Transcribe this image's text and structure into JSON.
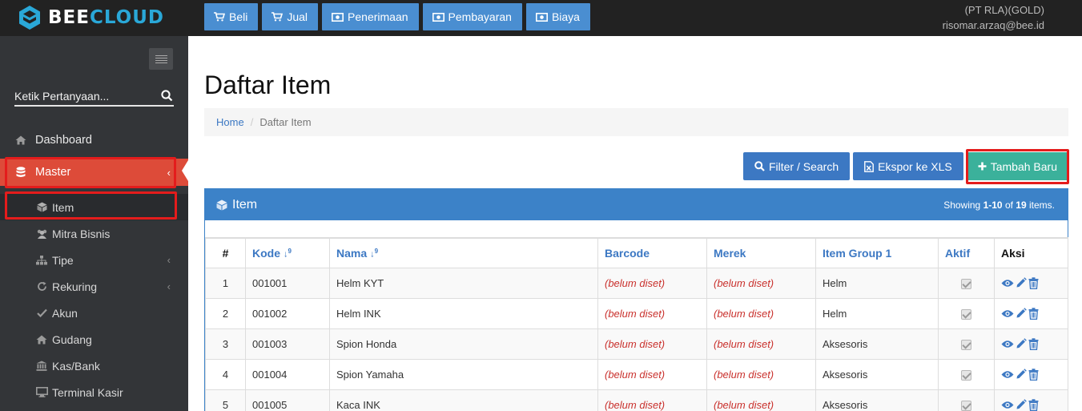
{
  "brand": {
    "part1": "BEE",
    "part2": "CLOUD"
  },
  "topnav": [
    {
      "icon": "cart-icon",
      "label": "Beli"
    },
    {
      "icon": "cart-icon",
      "label": "Jual"
    },
    {
      "icon": "money-icon",
      "label": "Penerimaan"
    },
    {
      "icon": "money-icon",
      "label": "Pembayaran"
    },
    {
      "icon": "money-icon",
      "label": "Biaya"
    }
  ],
  "company": {
    "name": "(PT RLA)(GOLD)",
    "email": "risomar.arzaq@bee.id"
  },
  "sidebar": {
    "search_placeholder": "Ketik Pertanyaan...",
    "items": [
      {
        "label": "Dashboard",
        "icon": "home-icon"
      },
      {
        "label": "Master",
        "icon": "database-icon",
        "active": true
      },
      {
        "label": "Item",
        "icon": "cube-icon",
        "active": true
      },
      {
        "label": "Mitra Bisnis",
        "icon": "users-icon"
      },
      {
        "label": "Tipe",
        "icon": "sitemap-icon"
      },
      {
        "label": "Rekuring",
        "icon": "refresh-icon"
      },
      {
        "label": "Akun",
        "icon": "check-icon"
      },
      {
        "label": "Gudang",
        "icon": "home-icon"
      },
      {
        "label": "Kas/Bank",
        "icon": "bank-icon"
      },
      {
        "label": "Terminal Kasir",
        "icon": "monitor-icon"
      }
    ]
  },
  "page": {
    "title": "Daftar Item",
    "breadcrumb": {
      "home": "Home",
      "current": "Daftar Item"
    },
    "actions": {
      "filter": "Filter / Search",
      "export": "Ekspor ke XLS",
      "add": "Tambah Baru"
    }
  },
  "panel": {
    "title": "Item",
    "showing_prefix": "Showing ",
    "showing_range": "1-10",
    "showing_mid": " of ",
    "showing_total": "19",
    "showing_suffix": " items."
  },
  "table": {
    "headers": {
      "no": "#",
      "kode": "Kode",
      "nama": "Nama",
      "barcode": "Barcode",
      "merek": "Merek",
      "group": "Item Group 1",
      "aktif": "Aktif",
      "aksi": "Aksi"
    },
    "rows": [
      {
        "no": "1",
        "kode": "001001",
        "nama": "Helm KYT",
        "barcode": "(belum diset)",
        "merek": "(belum diset)",
        "group": "Helm"
      },
      {
        "no": "2",
        "kode": "001002",
        "nama": "Helm INK",
        "barcode": "(belum diset)",
        "merek": "(belum diset)",
        "group": "Helm"
      },
      {
        "no": "3",
        "kode": "001003",
        "nama": "Spion Honda",
        "barcode": "(belum diset)",
        "merek": "(belum diset)",
        "group": "Aksesoris"
      },
      {
        "no": "4",
        "kode": "001004",
        "nama": "Spion Yamaha",
        "barcode": "(belum diset)",
        "merek": "(belum diset)",
        "group": "Aksesoris"
      },
      {
        "no": "5",
        "kode": "001005",
        "nama": "Kaca INK",
        "barcode": "(belum diset)",
        "merek": "(belum diset)",
        "group": "Aksesoris"
      }
    ]
  },
  "colors": {
    "primary": "#3c78c3",
    "success": "#3bb19b",
    "danger": "#dd4b39",
    "sidebar": "#333538",
    "topbar": "#222222"
  }
}
